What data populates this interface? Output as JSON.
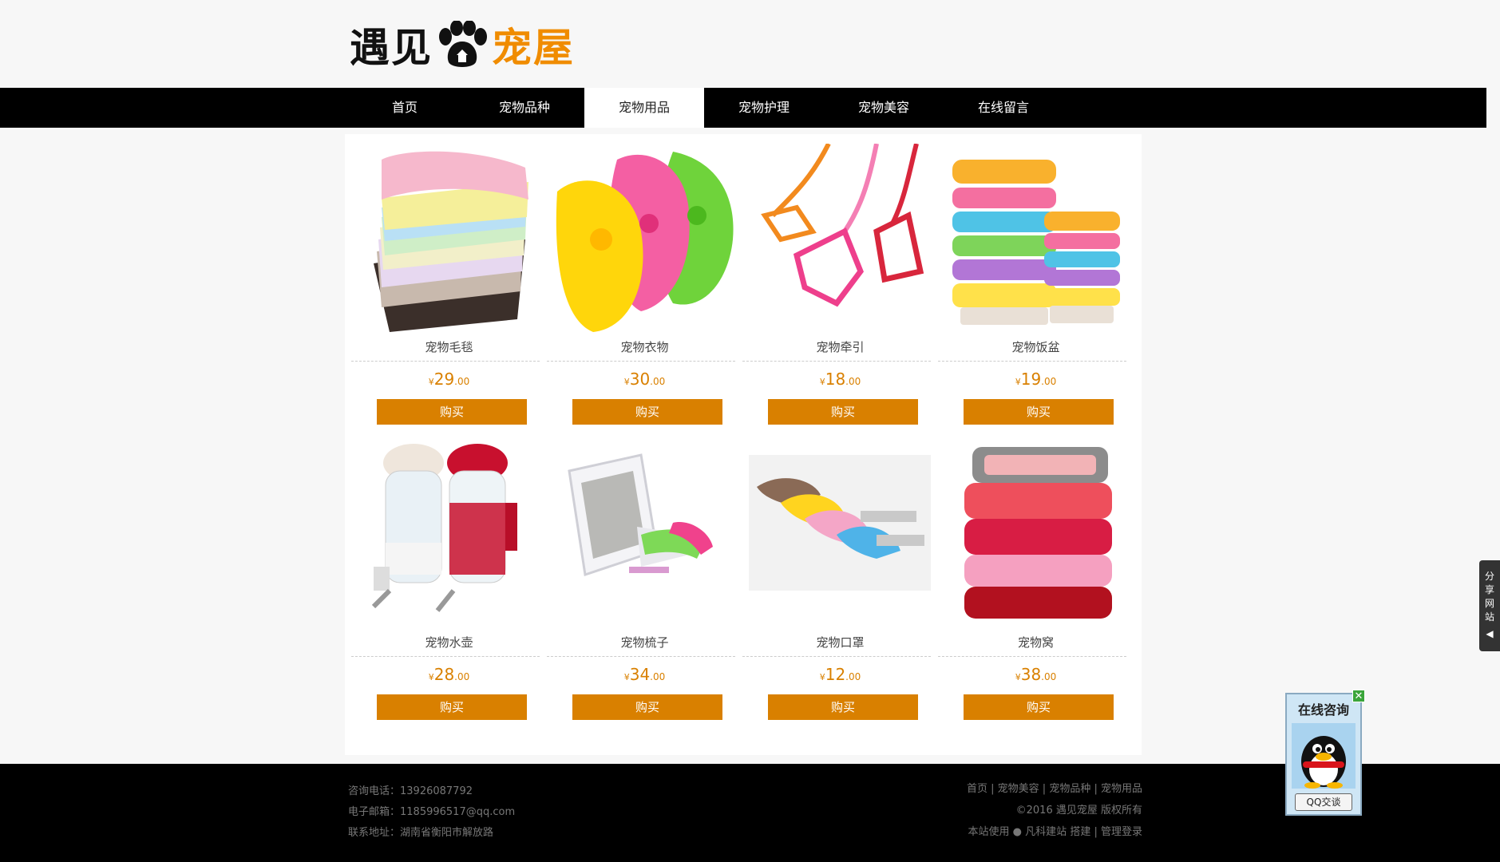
{
  "logo": {
    "part1": "遇见",
    "part2": "宠屋"
  },
  "nav": [
    {
      "label": "首页",
      "active": false
    },
    {
      "label": "宠物品种",
      "active": false
    },
    {
      "label": "宠物用品",
      "active": true
    },
    {
      "label": "宠物护理",
      "active": false
    },
    {
      "label": "宠物美容",
      "active": false
    },
    {
      "label": "在线留言",
      "active": false
    }
  ],
  "products": [
    {
      "name": "宠物毛毯",
      "yen": "¥",
      "int": "29",
      "dec": ".00",
      "buy": "购买",
      "image": "blanket-stack"
    },
    {
      "name": "宠物衣物",
      "yen": "¥",
      "int": "30",
      "dec": ".00",
      "buy": "购买",
      "image": "pet-clothes"
    },
    {
      "name": "宠物牵引",
      "yen": "¥",
      "int": "18",
      "dec": ".00",
      "buy": "购买",
      "image": "harness-leash"
    },
    {
      "name": "宠物饭盆",
      "yen": "¥",
      "int": "19",
      "dec": ".00",
      "buy": "购买",
      "image": "bowl-stack"
    },
    {
      "name": "宠物水壶",
      "yen": "¥",
      "int": "28",
      "dec": ".00",
      "buy": "购买",
      "image": "water-bottle"
    },
    {
      "name": "宠物梳子",
      "yen": "¥",
      "int": "34",
      "dec": ".00",
      "buy": "购买",
      "image": "pet-brush"
    },
    {
      "name": "宠物口罩",
      "yen": "¥",
      "int": "12",
      "dec": ".00",
      "buy": "购买",
      "image": "muzzle"
    },
    {
      "name": "宠物窝",
      "yen": "¥",
      "int": "38",
      "dec": ".00",
      "buy": "购买",
      "image": "pet-bed"
    }
  ],
  "footer": {
    "phone": "咨询电话：13926087792",
    "email": "电子邮箱：1185996517@qq.com",
    "address": "联系地址：湖南省衡阳市解放路",
    "links": [
      "首页",
      "宠物美容",
      "宠物品种",
      "宠物用品"
    ],
    "copyright": "©2016 遇见宠屋 版权所有",
    "powered_prefix": "本站使用",
    "powered_brand": "凡科建站",
    "build": "搭建",
    "admin": "管理登录"
  },
  "share": {
    "label": "分享网站"
  },
  "qq": {
    "title": "在线咨询",
    "button": "QQ交谈",
    "close": "✕"
  },
  "colors": {
    "accent": "#d98000",
    "nav_bg": "#000000",
    "logo_orange": "#f08c00"
  }
}
